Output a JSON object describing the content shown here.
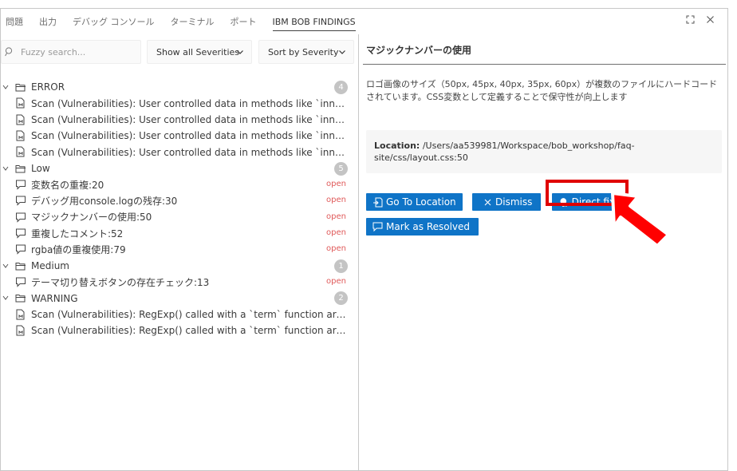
{
  "panel": {
    "tabs": [
      "問題",
      "出力",
      "デバッグ コンソール",
      "ターミナル",
      "ポート",
      "IBM BOB FINDINGS"
    ],
    "active_tab": "IBM BOB FINDINGS"
  },
  "toolbar": {
    "search_placeholder": "Fuzzy search...",
    "severity_filter": "Show all Severities",
    "sort": "Sort by Severity"
  },
  "groups": [
    {
      "name": "ERROR",
      "count": "4",
      "items": [
        {
          "label": "Scan (Vulnerabilities): User controlled data in methods like `innerHT...",
          "status": ""
        },
        {
          "label": "Scan (Vulnerabilities): User controlled data in methods like `innerHT...",
          "status": ""
        },
        {
          "label": "Scan (Vulnerabilities): User controlled data in methods like `innerHT...",
          "status": ""
        },
        {
          "label": "Scan (Vulnerabilities): User controlled data in methods like `innerHT...",
          "status": ""
        }
      ]
    },
    {
      "name": "Low",
      "count": "5",
      "items": [
        {
          "label": "変数名の重複:20",
          "status": "open"
        },
        {
          "label": "デバッグ用console.logの残存:30",
          "status": "open"
        },
        {
          "label": "マジックナンバーの使用:50",
          "status": "open"
        },
        {
          "label": "重複したコメント:52",
          "status": "open"
        },
        {
          "label": "rgba値の重複使用:79",
          "status": "open"
        }
      ]
    },
    {
      "name": "Medium",
      "count": "1",
      "items": [
        {
          "label": "テーマ切り替えボタンの存在チェック:13",
          "status": "open"
        }
      ]
    },
    {
      "name": "WARNING",
      "count": "2",
      "items": [
        {
          "label": "Scan (Vulnerabilities): RegExp() called with a `term` function argume...",
          "status": ""
        },
        {
          "label": "Scan (Vulnerabilities): RegExp() called with a `term` function argume...",
          "status": ""
        }
      ]
    }
  ],
  "detail": {
    "title": "マジックナンバーの使用",
    "description": "ロゴ画像のサイズ（50px, 45px, 40px, 35px, 60px）が複数のファイルにハードコードされています。CSS変数として定義することで保守性が向上します",
    "location_label": "Location:",
    "location_path": "/Users/aa539981/Workspace/bob_workshop/faq-site/css/layout.css:50",
    "buttons": {
      "go_to_location": "Go To Location",
      "dismiss": "Dismiss",
      "direct_fix": "Direct fix",
      "mark_resolved": "Mark as Resolved"
    }
  },
  "colors": {
    "accent": "#0f74c7",
    "status_open": "#e05a5a",
    "highlight": "#e00000"
  }
}
